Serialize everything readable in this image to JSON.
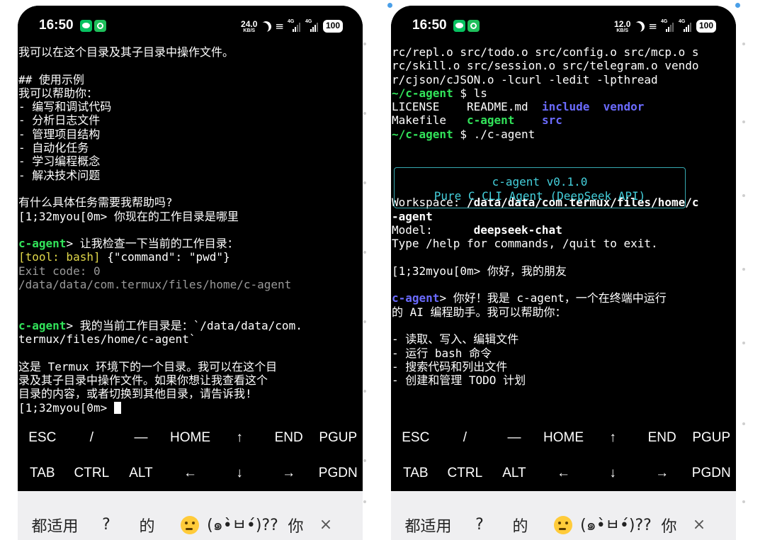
{
  "status_bar": {
    "time": "16:50",
    "battery": "100",
    "signal_label": "4G",
    "left_speed": {
      "value": "24.0",
      "unit": "KB/S"
    },
    "right_speed": {
      "value": "12.0",
      "unit": "KB/S"
    }
  },
  "left_terminal": {
    "lines": [
      "我可以在这个目录及其子目录中操作文件。",
      "",
      "## 使用示例",
      "我可以帮助你：",
      "- 编写和调试代码",
      "- 分析日志文件",
      "- 管理项目结构",
      "- 自动化任务",
      "- 学习编程概念",
      "- 解决技术问题",
      "",
      "有什么具体任务需要我帮助吗?",
      "[1;32myou[0m> 你现在的工作目录是哪里",
      "",
      "c-agent> 让我检查一下当前的工作目录：",
      "[tool: bash] {\"command\": \"pwd\"}",
      "Exit code: 0",
      "/data/data/com.termux/files/home/c-agent",
      "",
      "",
      "c-agent> 我的当前工作目录是：`/data/data/com.",
      "termux/files/home/c-agent`",
      "",
      "这是 Termux 环境下的一个目录。我可以在这个目",
      "录及其子目录中操作文件。如果你想让我查看这个",
      "目录的内容，或者切换到其他目录，请告诉我!",
      "[1;32myou[0m> "
    ],
    "prompt_label": "c-agent",
    "tool_prefix": "[tool: bash]",
    "tool_args": " {\"command\": \"pwd\"}"
  },
  "right_terminal": {
    "lines": [
      "rc/repl.o src/todo.o src/config.o src/mcp.o s",
      "rc/skill.o src/session.o src/telegram.o vendo",
      "r/cjson/cJSON.o -lcurl -ledit -lpthread",
      "~/c-agent $ ls",
      "LICENSE    README.md  include  vendor",
      "Makefile   c-agent    src",
      "~/c-agent $ ./c-agent",
      "Workspace: /data/data/com.termux/files/home/c",
      "-agent",
      "Model:      deepseek-chat",
      "Type /help for commands, /quit to exit.",
      "[1;32myou[0m> 你好，我的朋友",
      "c-agent> 你好！我是 c-agent，一个在终端中运行",
      "的 AI 编程助手。我可以帮助你：",
      "- 读取、写入、编辑文件",
      "- 运行 bash 命令",
      "- 搜索代码和列出文件",
      "- 创建和管理 TODO 计划"
    ],
    "banner_title": "c-agent v0.1.0",
    "banner_subtitle": "Pure C CLI Agent (DeepSeek API)",
    "prompt_path": "~/c-agent",
    "ls_files": {
      "license": "LICENSE",
      "readme": "README.md",
      "include": "include",
      "vendor": "vendor",
      "makefile": "Makefile",
      "binary": "c-agent",
      "src": "src"
    },
    "workspace_label": "Workspace:",
    "workspace_value": " /data/data/com.termux/files/home/c",
    "workspace_cont": "-agent",
    "model_label": "Model:",
    "model_value": "      deepseek-chat"
  },
  "extra_keys": {
    "row1": [
      "ESC",
      "/",
      "—",
      "HOME",
      "↑",
      "END",
      "PGUP"
    ],
    "row2": [
      "TAB",
      "CTRL",
      "ALT",
      "←",
      "↓",
      "→",
      "PGDN"
    ]
  },
  "suggestions": {
    "items": [
      "都适用",
      "?",
      "的",
      "(๑•̀ㅂ•́)??",
      "你"
    ],
    "close": "×"
  },
  "colors": {
    "prompt_green": "#32e35a",
    "dir_blue": "#6b6bff",
    "tool_yellow": "#e1d84a",
    "banner_cyan": "#44d0dc"
  }
}
